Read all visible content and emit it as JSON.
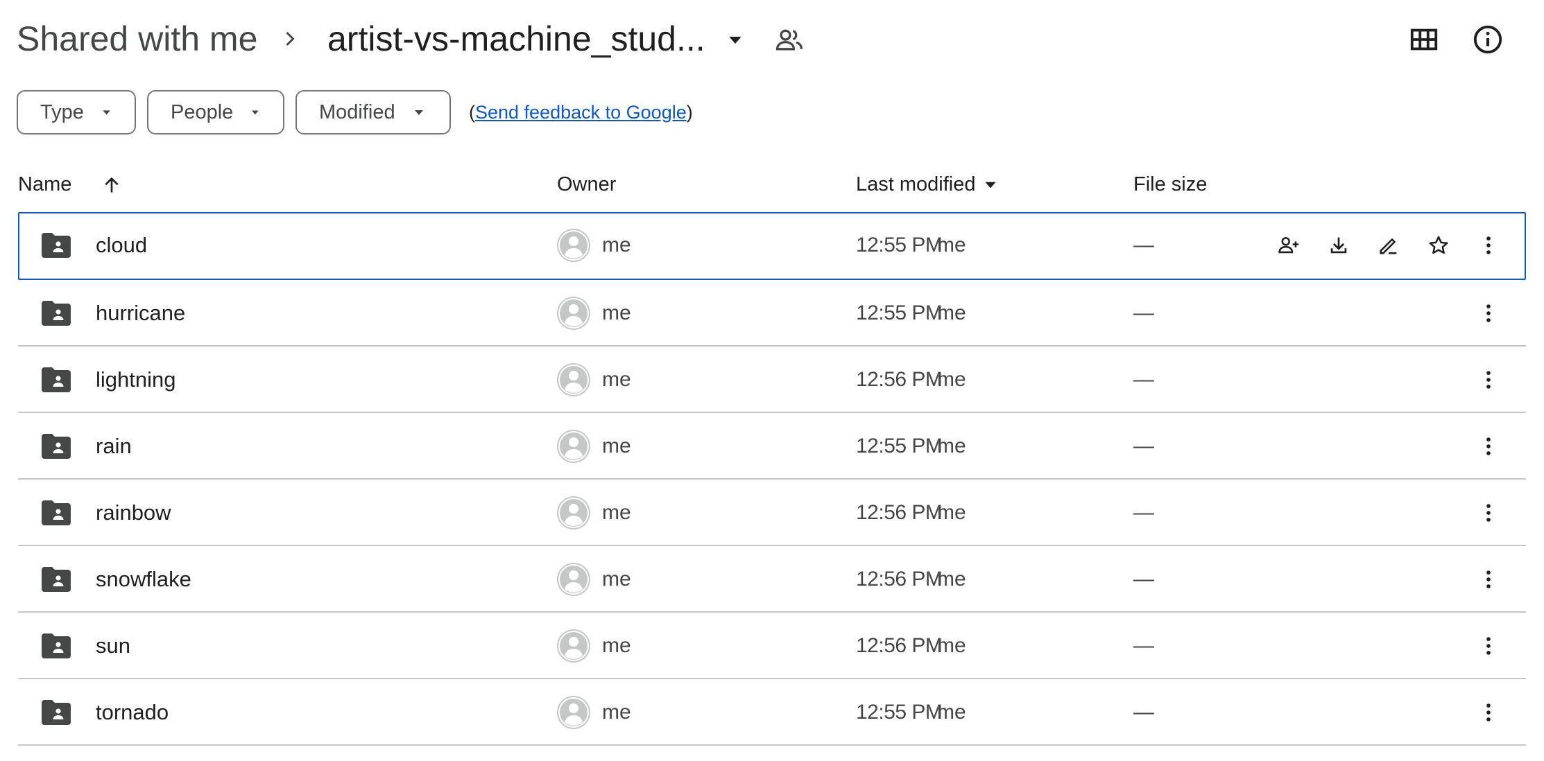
{
  "breadcrumb": {
    "root": "Shared with me",
    "current": "artist-vs-machine_stud..."
  },
  "filters": {
    "type": "Type",
    "people": "People",
    "modified": "Modified",
    "feedback_open": "(",
    "feedback_link": "Send feedback to Google",
    "feedback_close": ")"
  },
  "columns": {
    "name": "Name",
    "owner": "Owner",
    "last_modified": "Last modified",
    "file_size": "File size"
  },
  "colors": {
    "accent": "#0b57d0",
    "icon": "#444746",
    "divider": "#c4c7c5",
    "avatar": "#c4c7c5"
  },
  "rows": [
    {
      "name": "cloud",
      "owner": "me",
      "time": "12:55 PM",
      "modified_by": "me",
      "size": "—",
      "selected": true
    },
    {
      "name": "hurricane",
      "owner": "me",
      "time": "12:55 PM",
      "modified_by": "me",
      "size": "—"
    },
    {
      "name": "lightning",
      "owner": "me",
      "time": "12:56 PM",
      "modified_by": "me",
      "size": "—"
    },
    {
      "name": "rain",
      "owner": "me",
      "time": "12:55 PM",
      "modified_by": "me",
      "size": "—"
    },
    {
      "name": "rainbow",
      "owner": "me",
      "time": "12:56 PM",
      "modified_by": "me",
      "size": "—"
    },
    {
      "name": "snowflake",
      "owner": "me",
      "time": "12:56 PM",
      "modified_by": "me",
      "size": "—"
    },
    {
      "name": "sun",
      "owner": "me",
      "time": "12:56 PM",
      "modified_by": "me",
      "size": "—"
    },
    {
      "name": "tornado",
      "owner": "me",
      "time": "12:55 PM",
      "modified_by": "me",
      "size": "—"
    }
  ]
}
